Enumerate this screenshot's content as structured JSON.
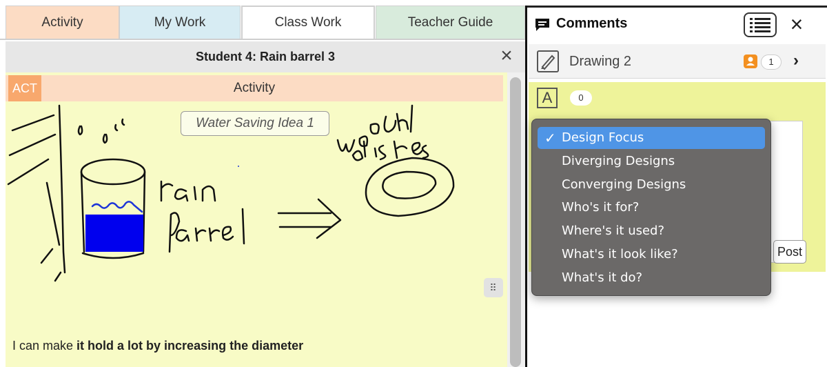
{
  "tabs": [
    {
      "label": "Activity"
    },
    {
      "label": "My Work"
    },
    {
      "label": "Class Work"
    },
    {
      "label": "Teacher Guide"
    }
  ],
  "work": {
    "title": "Student 4: Rain barrel 3",
    "act_badge": "ACT",
    "section_label": "Activity",
    "idea_label": "Water Saving Idea 1",
    "caption_plain": "I can make ",
    "caption_bold": "it hold a lot by increasing the diameter",
    "close_icon": "close-icon"
  },
  "comments": {
    "title": "Comments",
    "document": {
      "title": "Drawing 2",
      "count": "1"
    },
    "annotation": {
      "count": "0"
    },
    "post_label": "Post",
    "menu": {
      "selected": "Design Focus",
      "items": [
        "Design Focus",
        "Diverging Designs",
        "Converging Designs",
        "Who's it for?",
        "Where's it used?",
        "What's it look like?",
        "What's it do?"
      ]
    }
  },
  "colors": {
    "activity_tab": "#fcdcc4",
    "canvas_bg": "#f8fbc6",
    "menu_selected": "#4f95e6",
    "user_badge": "#f39020"
  }
}
